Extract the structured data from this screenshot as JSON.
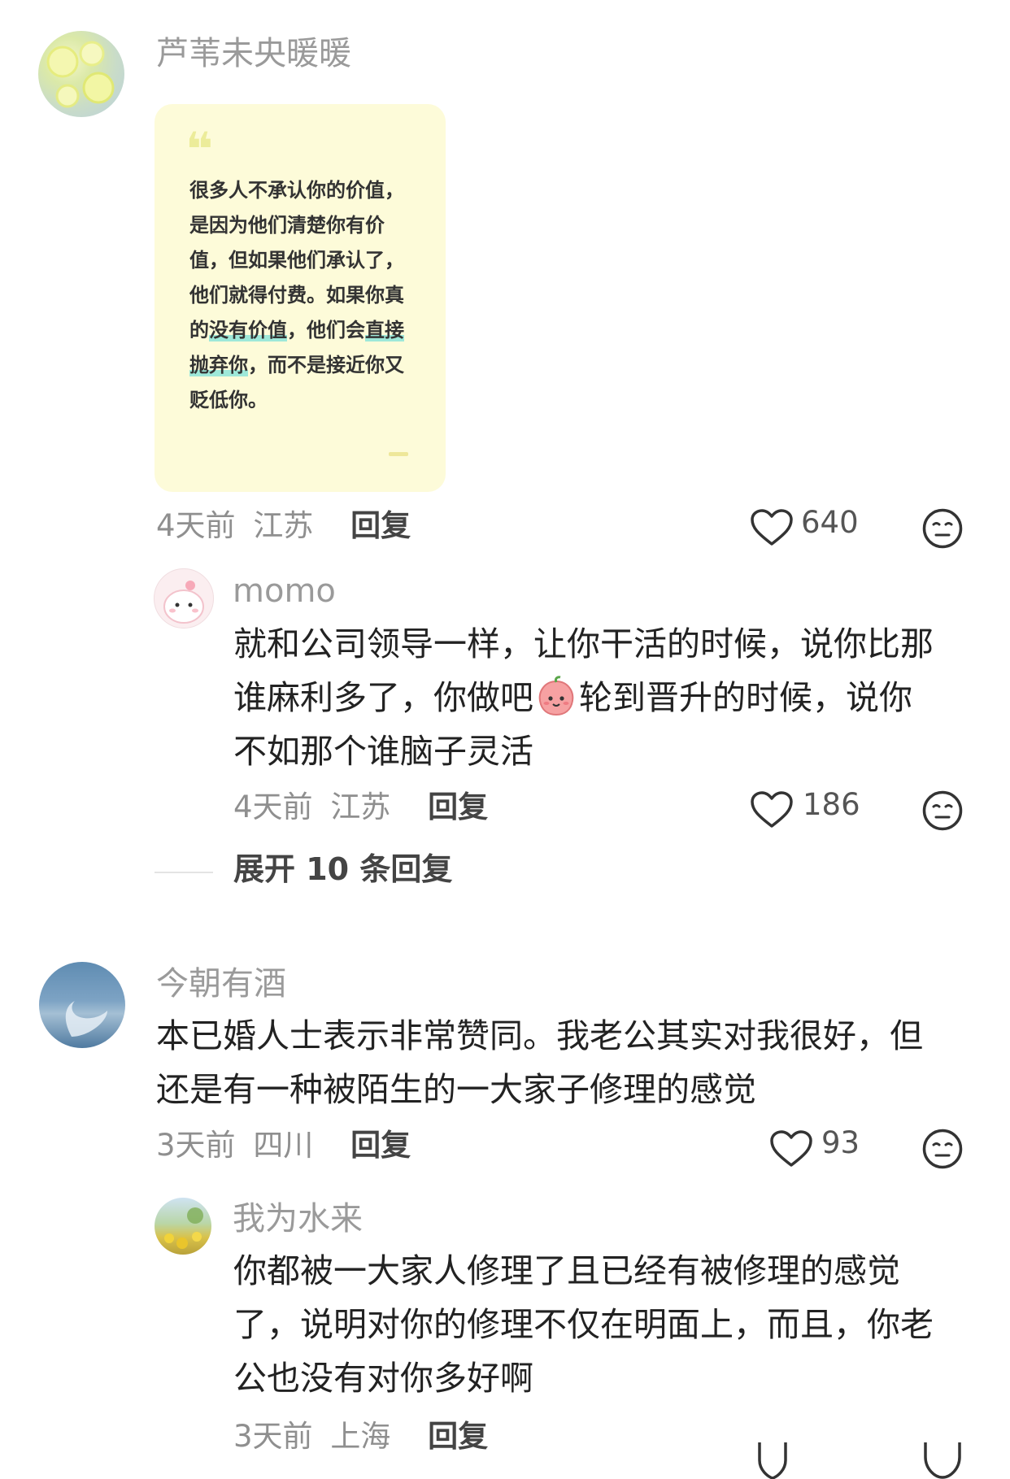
{
  "comments": [
    {
      "user": "芦苇未央暖暖",
      "quote_card": {
        "quote_mark": "❝",
        "lines": [
          "很多人不承认你的价值，",
          "是因为他们清楚你有价",
          "值，但如果他们承认了，",
          "他们就得付费。如果你真"
        ],
        "line5": {
          "pre": "的",
          "hl1": "没有价值",
          "mid": "，他们会",
          "hl2": "直接"
        },
        "line6": {
          "hl": "抛弃你",
          "post": "，而不是接近你又"
        },
        "line7": "贬低你。"
      },
      "time": "4天前",
      "location": "江苏",
      "reply_label": "回复",
      "likes": "640",
      "replies": [
        {
          "user": "momo",
          "text_lines": [
            "就和公司领导一样，让你干活的时候，说你比那"
          ],
          "text_line2_pre": "谁麻利多了，你做吧",
          "text_line2_post": "轮到晋升的时候，说你",
          "text_line3": "不如那个谁脑子灵活",
          "time": "4天前",
          "location": "江苏",
          "reply_label": "回复",
          "likes": "186"
        }
      ],
      "expand_label": "展开 10 条回复"
    },
    {
      "user": "今朝有酒",
      "text_lines": [
        "本已婚人士表示非常赞同。我老公其实对我很好，但",
        "还是有一种被陌生的一大家子修理的感觉"
      ],
      "time": "3天前",
      "location": "四川",
      "reply_label": "回复",
      "likes": "93",
      "replies": [
        {
          "user": "我为水来",
          "text_lines": [
            "你都被一大家人修理了且已经有被修理的感觉",
            "了，说明对你的修理不仅在明面上，而且，你老",
            "公也没有对你多好啊"
          ],
          "time": "3天前",
          "location": "上海",
          "reply_label": "回复"
        }
      ]
    }
  ],
  "icons": {
    "like": "heart-outline-icon",
    "dislike": "meh-face-icon",
    "emoji": "peach-face-emoji"
  },
  "colors": {
    "quote_bg": "#fdfbd9",
    "highlight": "#9ee8d9",
    "meta": "#8f8f8f"
  }
}
